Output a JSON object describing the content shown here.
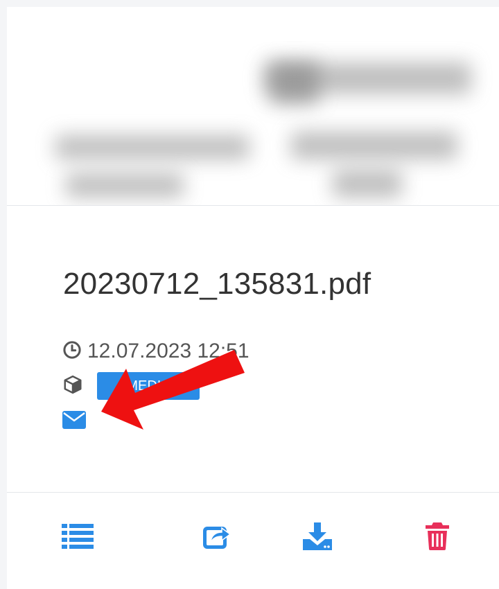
{
  "file": {
    "name": "20230712_135831.pdf",
    "date": "12.07.2023 12:51",
    "badge": "MEDIA"
  },
  "colors": {
    "accent": "#2b8ce6",
    "danger": "#e8305a",
    "arrow": "#ee1111"
  },
  "icons": [
    "clock-icon",
    "cube-icon",
    "envelope-icon",
    "list-icon",
    "share-icon",
    "download-icon",
    "trash-icon"
  ]
}
